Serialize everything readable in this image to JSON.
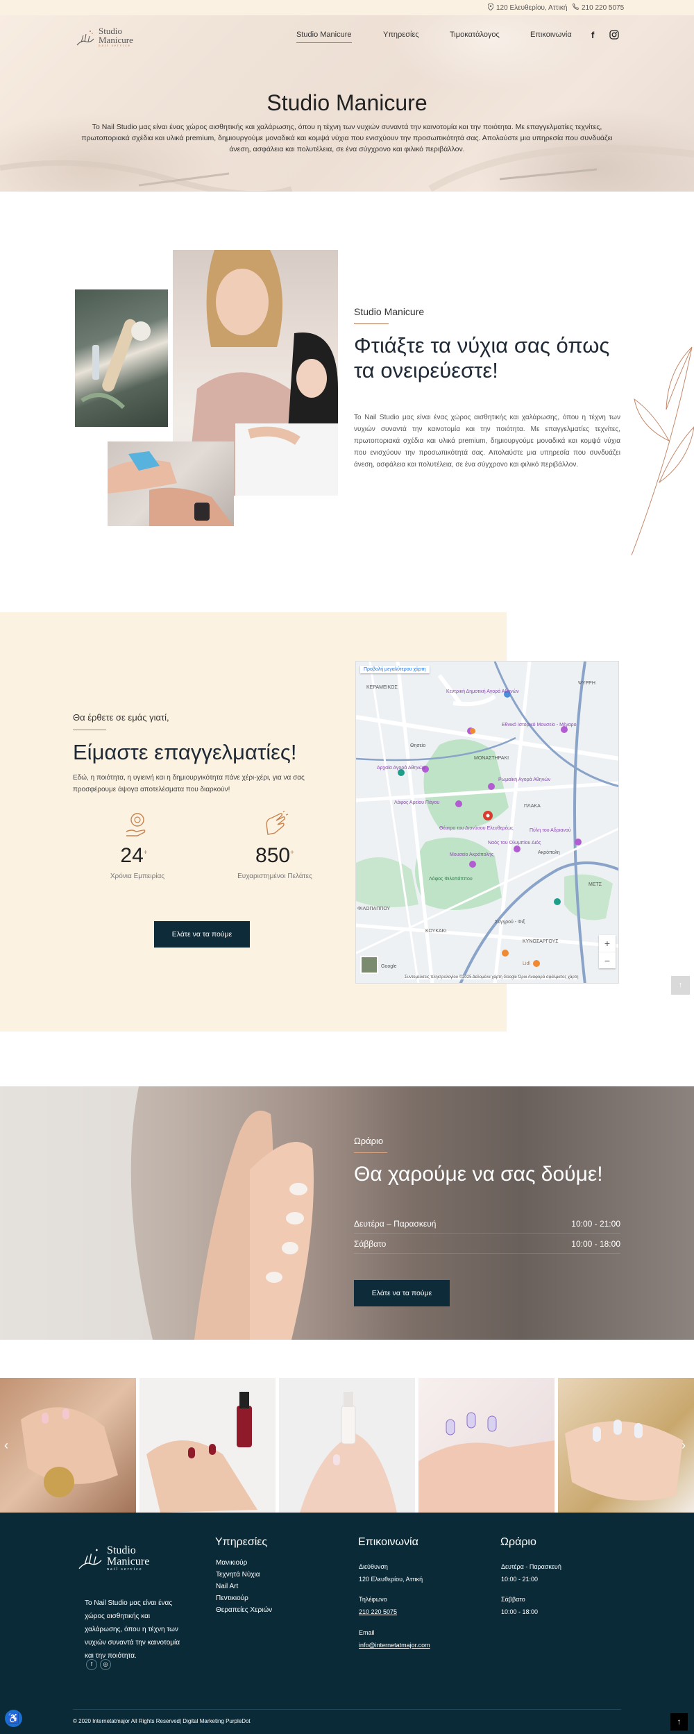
{
  "topbar": {
    "address": "120 Ελευθερίου, Αττική",
    "phone": "210 220 5075"
  },
  "logo": {
    "line1": "Studio",
    "line2": "Manicure",
    "tagline": "nail service"
  },
  "nav": {
    "items": [
      "Studio Manicure",
      "Υπηρεσίες",
      "Τιμοκατάλογος",
      "Επικοινωνία"
    ]
  },
  "hero": {
    "title": "Studio Manicure",
    "text": "Το Nail Studio μας είναι ένας χώρος αισθητικής και χαλάρωσης, όπου η τέχνη των νυχιών συναντά την καινοτομία και την ποιότητα. Με επαγγελματίες τεχνίτες, πρωτοποριακά σχέδια και υλικά premium, δημιουργούμε μοναδικά και κομψά νύχια που ενισχύουν την προσωπικότητά σας. Απολαύστε μια υπηρεσία που συνδυάζει άνεση, ασφάλεια και πολυτέλεια, σε ένα σύγχρονο και φιλικό περιβάλλον."
  },
  "about": {
    "subtitle": "Studio Manicure",
    "title": "Φτιάξτε τα νύχια σας όπως τα ονειρεύεστε!",
    "text": "Το Nail Studio μας είναι ένας χώρος αισθητικής και χαλάρωσης, όπου η τέχνη των νυχιών συναντά την καινοτομία και την ποιότητα. Με επαγγελματίες τεχνίτες, πρωτοποριακά σχέδια και υλικά premium, δημιουργούμε μοναδικά και κομψά νύχια που ενισχύουν την προσωπικότητά σας. Απολαύστε μια υπηρεσία που συνδυάζει άνεση, ασφάλεια και πολυτέλεια, σε ένα σύγχρονο και φιλικό περιβάλλον."
  },
  "pros": {
    "subtitle": "Θα έρθετε σε εμάς γιατί,",
    "title": "Είμαστε επαγγελματίες!",
    "text": "Εδώ, η ποιότητα, η υγιεινή και η δημιουργικότητα πάνε χέρι-χέρι, για να σας προσφέρουμε άψογα αποτελέσματα που διαρκούν!",
    "stats": [
      {
        "number": "24",
        "suffix": "+",
        "label": "Χρόνια Εμπειρίας"
      },
      {
        "number": "850",
        "suffix": "+",
        "label": "Ευχαριστημένοι Πελάτες"
      }
    ],
    "button": "Ελάτε να τα πούμε"
  },
  "map": {
    "larger_map": "Προβολή μεγαλύτερου χάρτη",
    "zoom_in": "+",
    "zoom_out": "−",
    "attribution": "Συντομεύσεις πληκτρολογίου   ©2025 Δεδομένα χάρτη Google   Όροι   Αναφορά σφάλματος χάρτη",
    "labels": {
      "kerameikos": "ΚΕΡΑΜΕΙΚΟΣ",
      "psyrri": "ΨΥΡΡΗ",
      "thiseio": "Θησείο",
      "monastiraki": "ΜΟΝΑΣΤΗΡΑΚΙ",
      "plaka": "ΠΛΑΚΑ",
      "mets": "ΜΕΤΣ",
      "koukaki": "ΚΟΥΚΑΚΙ",
      "kynosargous": "ΚΥΝΟΣΑΡΓΟΥΣ",
      "filopappou": "ΦΙΛΟΠΑΠΠΟΥ",
      "acropolis": "Ακρόπολη",
      "ancient_agora": "Αρχαία Αγορά Αθηνών",
      "roman_agora": "Ρωμαϊκή Αγορά Αθηνών",
      "areopagus": "Λόφος Αρείου Πάγου",
      "theatre": "Θέατρο του Διονύσου Ελευθερέως",
      "acropolis_museum": "Μουσείο Ακρόπολης",
      "temple_zeus": "Ναός του Ολυμπίου Διός",
      "central_market": "Κεντρική Δημοτική Αγορά Αθηνών",
      "filopappou_hill": "Λόφος Φιλοπάππου",
      "arch": "Πύλη του Αδριανού",
      "lidl": "Lidl",
      "syngrou": "Συγγρού - Φιξ",
      "google": "Google",
      "national_museum": "Εθνικό Ιστορικό Μουσείο - Μέγαρο"
    }
  },
  "hours": {
    "subtitle": "Ωράριο",
    "title": "Θα χαρούμε να σας δούμε!",
    "rows": [
      {
        "day": "Δευτέρα – Παρασκευή",
        "time": "10:00 - 21:00"
      },
      {
        "day": "Σάββατο",
        "time": "10:00 - 18:00"
      }
    ],
    "button": "Ελάτε να τα πούμε"
  },
  "footer": {
    "about": "Το Nail Studio μας είναι ένας χώρος αισθητικής και χαλάρωσης, όπου η τέχνη των νυχιών συναντά την καινοτομία και την ποιότητα.",
    "services_title": "Υπηρεσίες",
    "services": [
      "Μανικιούρ",
      "Τεχνητά Νύχια",
      "Nail Art",
      "Πεντικιούρ",
      "Θεραπείες Χεριών"
    ],
    "contact_title": "Επικοινωνία",
    "address_label": "Διεύθυνση",
    "address": "120 Ελευθερίου, Αττική",
    "phone_label": "Τηλέφωνο",
    "phone": "210 220 5075",
    "email_label": "Email",
    "email": "info@internetatmajor.com",
    "hours_title": "Ωράριο",
    "weekday_label": "Δευτέρα - Παρασκευή",
    "weekday_time": "10:00 - 21:00",
    "saturday_label": "Σάββατο",
    "saturday_time": "10:00 - 18:00",
    "copyright": "© 2020 Internetatmajor All Rights Reserved| Digital Marketing PurpleDot"
  },
  "colors": {
    "accent": "#b57551",
    "dark": "#0e2b3a",
    "cream": "#fcf2e2"
  }
}
